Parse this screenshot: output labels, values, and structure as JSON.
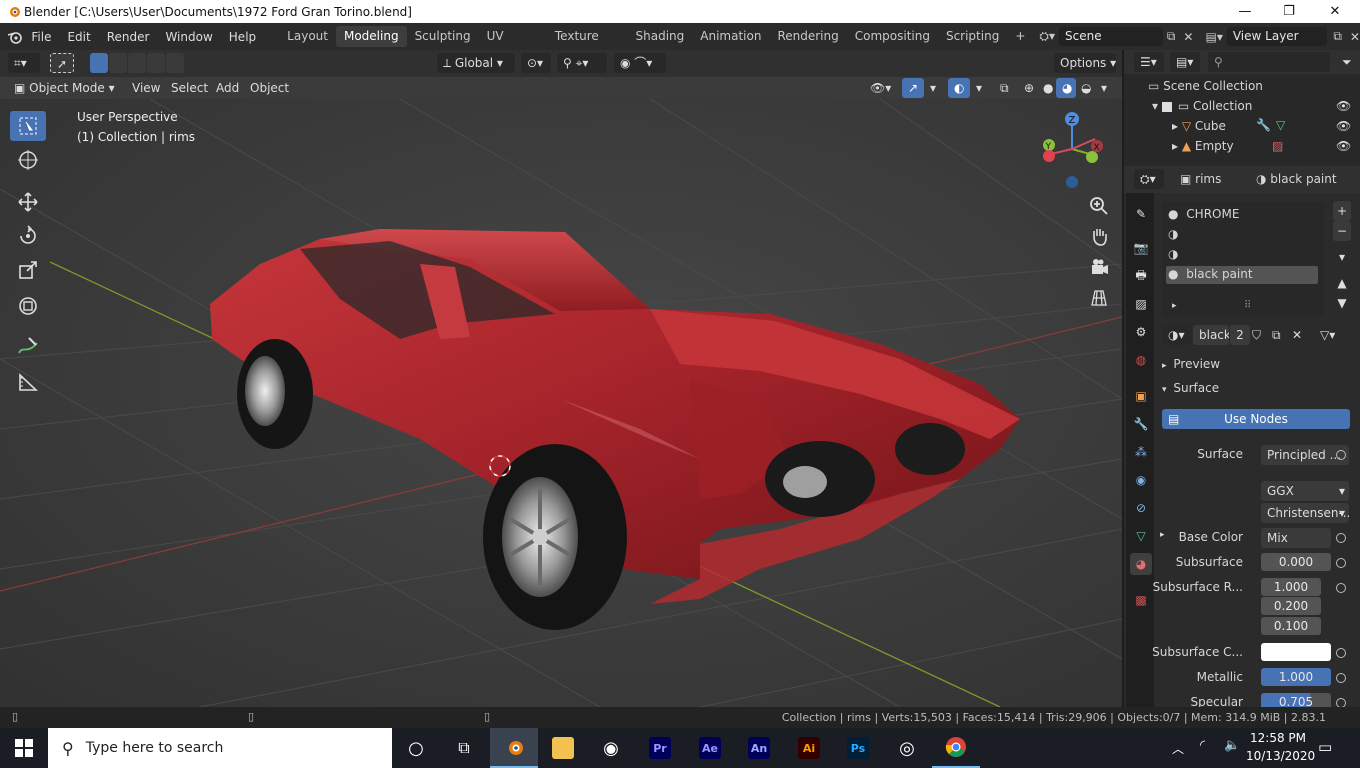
{
  "window": {
    "title": "Blender [C:\\Users\\User\\Documents\\1972 Ford Gran Torino.blend]",
    "minimize": "—",
    "maximize": "❐",
    "close": "✕"
  },
  "menu": {
    "file": "File",
    "edit": "Edit",
    "render": "Render",
    "window": "Window",
    "help": "Help"
  },
  "workspaces": [
    "Layout",
    "Modeling",
    "Sculpting",
    "UV Editing",
    "Texture Paint",
    "Shading",
    "Animation",
    "Rendering",
    "Compositing",
    "Scripting"
  ],
  "active_workspace": "Modeling",
  "scene": {
    "name": "Scene",
    "view_layer": "View Layer"
  },
  "viewport_header": {
    "transform_orientation": "Global",
    "options": "Options",
    "mode": "Object Mode",
    "view": "View",
    "select": "Select",
    "add": "Add",
    "object": "Object"
  },
  "viewport_overlay": {
    "perspective": "User Perspective",
    "context": "(1) Collection | rims"
  },
  "gizmo": {
    "z": "Z",
    "x": "X",
    "y": "Y"
  },
  "outliner": {
    "root": "Scene Collection",
    "items": [
      {
        "label": "Collection"
      },
      {
        "label": "Cube"
      },
      {
        "label": "Empty"
      }
    ]
  },
  "properties": {
    "object_name": "rims",
    "material_name": "black paint",
    "slots": [
      "CHROME",
      "",
      "",
      "black paint"
    ],
    "datablock": "black",
    "users": "2",
    "preview": "Preview",
    "surface_panel": "Surface",
    "use_nodes": "Use Nodes",
    "surface_label": "Surface",
    "surface_value": "Principled ...",
    "distribution": "GGX",
    "sss_method": "Christensen-...",
    "base_color_label": "Base Color",
    "base_color_value": "Mix",
    "subsurface_label": "Subsurface",
    "subsurface_value": "0.000",
    "subsurface_radius_label": "Subsurface R...",
    "subsurface_radius": [
      "1.000",
      "0.200",
      "0.100"
    ],
    "subsurface_color_label": "Subsurface C...",
    "metallic_label": "Metallic",
    "metallic_value": "1.000",
    "specular_label": "Specular",
    "specular_value": "0.705"
  },
  "statusbar": {
    "info": "Collection | rims | Verts:15,503 | Faces:15,414 | Tris:29,906 | Objects:0/7 | Mem: 314.9 MiB | 2.83.1"
  },
  "taskbar": {
    "search_placeholder": "Type here to search",
    "apps": [
      "Pr",
      "Ae",
      "An",
      "Ai",
      "Ps"
    ],
    "time": "12:58 PM",
    "date": "10/13/2020"
  },
  "colors": {
    "accent": "#4772b3",
    "car_red": "#b3262c",
    "premiere": "#9999ff",
    "after_effects": "#9999ff",
    "animate": "#a3a8ff",
    "illustrator": "#ff9a00",
    "photoshop": "#31a8ff"
  }
}
